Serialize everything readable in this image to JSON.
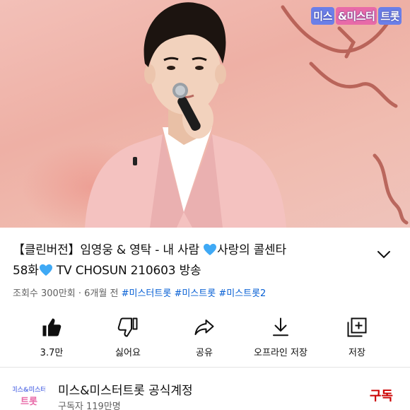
{
  "video": {
    "logo_parts": [
      "미스",
      "&미스터",
      "트롯"
    ],
    "title": "【클린버전】임영웅 & 영탁 - 내 사람 💙사랑의 콜센타 58화💙 TV CHOSUN 210603 방송",
    "title_line1": "【클린버전】임영웅 & 영탁 - 내 사람 ",
    "title_line1_end": "사랑의 콜센타",
    "title_line2_start": "58화",
    "title_line2_end": " TV CHOSUN 210603 방송",
    "views": "조회수 300만회",
    "separator": " · ",
    "age": "6개월 전",
    "hashtags": [
      "#미스터트롯",
      "#미스트롯",
      "#미스트롯2"
    ]
  },
  "actions": [
    {
      "label": "3.7만",
      "icon": "thumbs-up-filled-icon"
    },
    {
      "label": "싫어요",
      "icon": "thumbs-down-icon"
    },
    {
      "label": "공유",
      "icon": "share-icon"
    },
    {
      "label": "오프라인 저장",
      "icon": "download-icon"
    },
    {
      "label": "저장",
      "icon": "add-to-playlist-icon"
    }
  ],
  "channel": {
    "avatar_text_top": "미스&미스터",
    "avatar_text_bottom": "트롯",
    "name": "미스&미스터트롯 공식계정",
    "subscribers": "구독자 119만명",
    "subscribe_label": "구독"
  },
  "colors": {
    "accent_link": "#065fd4",
    "subscribe_red": "#cc0000",
    "heart_blue": "#3fa9f5"
  }
}
